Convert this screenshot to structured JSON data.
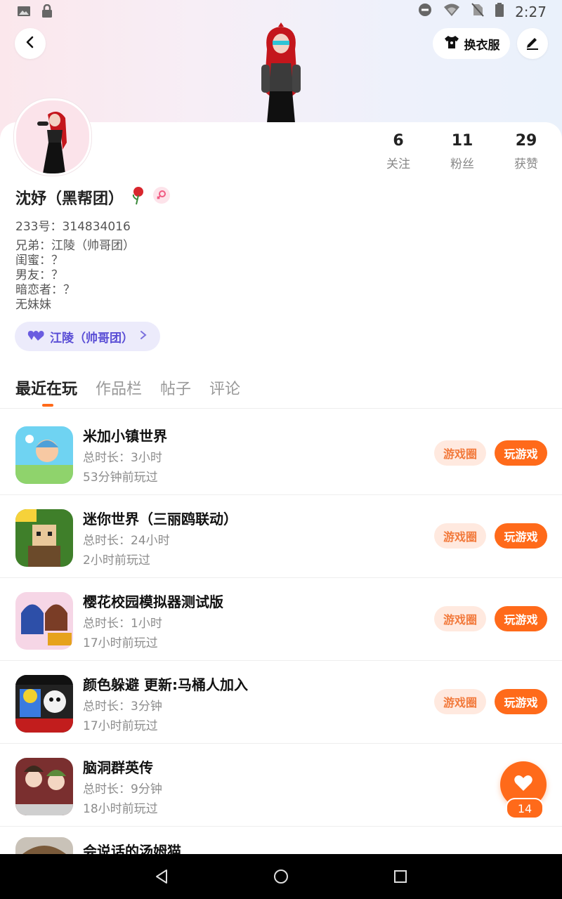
{
  "status_bar": {
    "time": "2:27",
    "left_icons": [
      "image-icon",
      "lock-icon"
    ],
    "right_icons": [
      "do-not-disturb-icon",
      "wifi-icon",
      "no-sim-icon",
      "battery-icon"
    ]
  },
  "header": {
    "back_icon": "chevron-left-icon",
    "outfit_label": "换衣服",
    "outfit_icon": "tshirt-icon",
    "edit_icon": "pen-icon"
  },
  "profile": {
    "name": "沈妤（黑帮团）",
    "uid": "233号：314834016",
    "bio": [
      "兄弟：江陵（帅哥团）",
      "闺蜜：？",
      "男友：？",
      "暗恋者：？",
      "无妹妹"
    ],
    "relation_label": "江陵（帅哥团）",
    "stats": [
      {
        "num": "6",
        "label": "关注"
      },
      {
        "num": "11",
        "label": "粉丝"
      },
      {
        "num": "29",
        "label": "获赞"
      }
    ]
  },
  "tabs": [
    {
      "label": "最近在玩"
    },
    {
      "label": "作品栏"
    },
    {
      "label": "帖子"
    },
    {
      "label": "评论"
    }
  ],
  "games": [
    {
      "title": "米加小镇世界",
      "duration": "总时长：3小时",
      "last": "53分钟前玩过",
      "circle": "游戏圈",
      "play": "玩游戏"
    },
    {
      "title": "迷你世界（三丽鸥联动）",
      "duration": "总时长：24小时",
      "last": "2小时前玩过",
      "circle": "游戏圈",
      "play": "玩游戏"
    },
    {
      "title": "樱花校园模拟器测试版",
      "duration": "总时长：1小时",
      "last": "17小时前玩过",
      "circle": "游戏圈",
      "play": "玩游戏"
    },
    {
      "title": "颜色躲避 更新:马桶人加入",
      "duration": "总时长：3分钟",
      "last": "17小时前玩过",
      "circle": "游戏圈",
      "play": "玩游戏"
    },
    {
      "title": "脑洞群英传",
      "duration": "总时长：9分钟",
      "last": "18小时前玩过"
    },
    {
      "title": "会说话的汤姆猫"
    }
  ],
  "fab": {
    "count": "14",
    "icon": "heart-icon"
  },
  "colors": {
    "accent": "#ff6a1a",
    "circle_bg": "#ffe9df",
    "relation_bg": "#ecebfb",
    "relation_text": "#5b4fd6"
  }
}
